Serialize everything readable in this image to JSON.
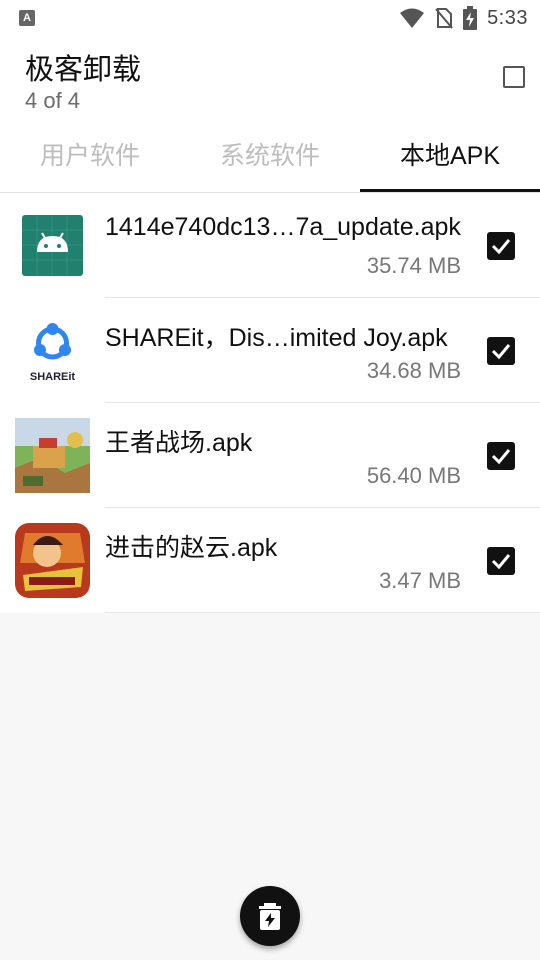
{
  "status_bar": {
    "time": "5:33",
    "notification_icon_letter": "A"
  },
  "header": {
    "title": "极客卸载",
    "subtitle": "4 of 4"
  },
  "tabs": [
    {
      "label": "用户软件",
      "active": false
    },
    {
      "label": "系统软件",
      "active": false
    },
    {
      "label": "本地APK",
      "active": true
    }
  ],
  "files": [
    {
      "name": "1414e740dc13…7a_update.apk",
      "size": "35.74 MB",
      "checked": true,
      "icon": "android-icon"
    },
    {
      "name": "SHAREit，Dis…imited Joy.apk",
      "size": "34.68 MB",
      "checked": true,
      "icon": "shareit-icon",
      "icon_text": "SHAREit"
    },
    {
      "name": "王者战场.apk",
      "size": "56.40 MB",
      "checked": true,
      "icon": "game-icon"
    },
    {
      "name": "进击的赵云.apk",
      "size": "3.47 MB",
      "checked": true,
      "icon": "game-icon"
    }
  ],
  "colors": {
    "android_green": "#22806e",
    "shareit_blue": "#2f86f0",
    "checkbox": "#111111"
  }
}
